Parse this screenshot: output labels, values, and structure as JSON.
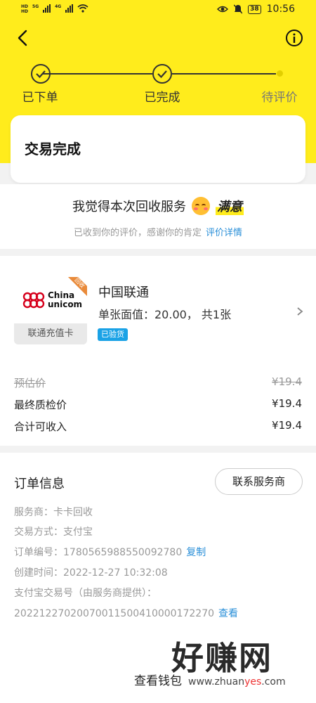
{
  "status_bar": {
    "sim_labels": [
      "HD",
      "HD"
    ],
    "network": [
      "5G",
      "4G"
    ],
    "battery": "38",
    "time": "10:56"
  },
  "progress": {
    "steps": [
      {
        "label": "已下单",
        "done": true
      },
      {
        "label": "已完成",
        "done": true
      },
      {
        "label": "待评价",
        "done": false
      }
    ]
  },
  "card": {
    "title": "交易完成"
  },
  "rating": {
    "text": "我觉得本次回收服务",
    "value": "满意",
    "subtext": "已收到你的评价，感谢你的肯定",
    "link": "评价详情"
  },
  "product": {
    "logo_text_1": "China",
    "logo_text_2": "unicom",
    "ribbon": "回收",
    "logo_label": "联通充值卡",
    "name": "中国联通",
    "face_value": "单张面值：20.00， 共1张",
    "badge": "已验货"
  },
  "prices": [
    {
      "label": "预估价",
      "value": "¥19.4"
    },
    {
      "label": "最终质检价",
      "value": "¥19.4"
    },
    {
      "label": "合计可收入",
      "value": "¥19.4"
    }
  ],
  "order": {
    "title": "订单信息",
    "contact_button": "联系服务商",
    "provider": "服务商：卡卡回收",
    "payment": "交易方式：支付宝",
    "order_no": "订单编号：1780565988550092780",
    "copy_link": "复制",
    "created": "创建时间：2022-12-27 10:32:08",
    "alipay_label": "支付宝交易号（由服务商提供）：",
    "alipay_no": "2022122702007001150041000017227​0",
    "view_link": "查看"
  },
  "bottom": {
    "wallet": "查看钱包"
  },
  "watermark": {
    "big": "好赚网",
    "small_prefix": "www.zhuan",
    "small_highlight": "yes",
    "small_suffix": ".com"
  },
  "colors": {
    "brand_yellow": "#ffec1c",
    "link_blue": "#2a8fd8",
    "badge_blue": "#1aa2e6"
  }
}
